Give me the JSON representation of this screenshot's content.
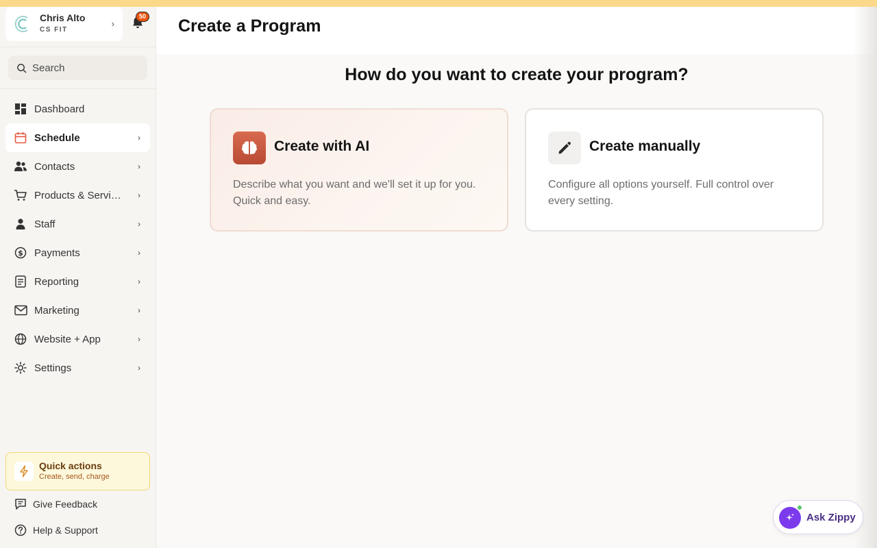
{
  "account": {
    "name": "Chris Alto",
    "org": "CS FIT"
  },
  "notifications": {
    "count": "50"
  },
  "search": {
    "placeholder": "Search"
  },
  "sidebar": {
    "items": [
      {
        "label": "Dashboard",
        "icon": "dashboard-icon"
      },
      {
        "label": "Schedule",
        "icon": "calendar-icon",
        "active": true
      },
      {
        "label": "Contacts",
        "icon": "contacts-icon"
      },
      {
        "label": "Products & Services",
        "icon": "cart-icon"
      },
      {
        "label": "Staff",
        "icon": "person-icon"
      },
      {
        "label": "Payments",
        "icon": "dollar-circle-icon"
      },
      {
        "label": "Reporting",
        "icon": "report-icon"
      },
      {
        "label": "Marketing",
        "icon": "mail-icon"
      },
      {
        "label": "Website + App",
        "icon": "globe-icon"
      },
      {
        "label": "Settings",
        "icon": "gear-icon"
      }
    ]
  },
  "quick_actions": {
    "title": "Quick actions",
    "subtitle": "Create, send, charge"
  },
  "footer": {
    "feedback": "Give Feedback",
    "help": "Help & Support"
  },
  "main": {
    "title": "Create a Program",
    "question": "How do you want to create your program?",
    "cards": [
      {
        "title": "Create with AI",
        "description": "Describe what you want and we'll set it up for you. Quick and easy.",
        "icon": "brain-icon"
      },
      {
        "title": "Create manually",
        "description": "Configure all options yourself. Full control over every setting.",
        "icon": "pencil-icon"
      }
    ]
  },
  "zippy": {
    "label": "Ask Zippy"
  },
  "colors": {
    "accent_orange": "#e9550f",
    "ai_icon": "#c9583f",
    "zippy_purple": "#7c3aed",
    "top_bar": "#fcd98a"
  }
}
